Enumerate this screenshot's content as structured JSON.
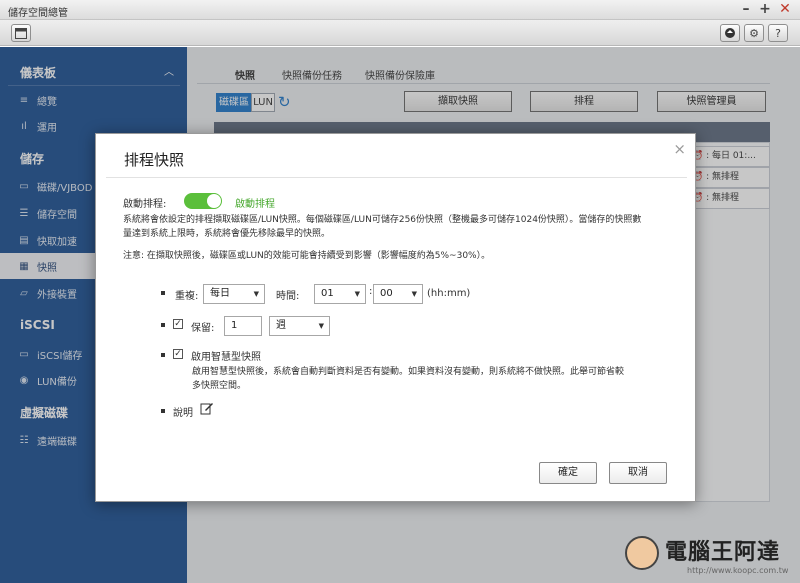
{
  "window": {
    "title": "儲存空間總管",
    "min": "–",
    "max": "+",
    "close": "✕"
  },
  "sidebar": {
    "sections": [
      {
        "label": "儀表板",
        "collapse": "︿"
      },
      {
        "label": "儲存"
      },
      {
        "label": "iSCSI"
      },
      {
        "label": "虛擬磁碟"
      }
    ],
    "items": [
      {
        "label": "總覽",
        "icon": "≡"
      },
      {
        "label": "運用",
        "icon": "ıl"
      },
      {
        "label": "磁碟/VJBOD",
        "icon": "▭"
      },
      {
        "label": "儲存空間",
        "icon": "☰"
      },
      {
        "label": "快取加速",
        "icon": "▤"
      },
      {
        "label": "快照",
        "icon": "▦"
      },
      {
        "label": "外接裝置",
        "icon": "▱"
      },
      {
        "label": "iSCSI儲存",
        "icon": "▭"
      },
      {
        "label": "LUN備份",
        "icon": "◉"
      },
      {
        "label": "遠端磁碟",
        "icon": "☷"
      }
    ]
  },
  "main": {
    "tabs": [
      "快照",
      "快照備份任務",
      "快照備份保險庫"
    ],
    "segments": [
      "磁碟區",
      "LUN"
    ],
    "buttons": [
      "擷取快照",
      "排程",
      "快照管理員"
    ],
    "rows": [
      "每日 01:...",
      "無排程",
      "無排程"
    ]
  },
  "dialog": {
    "title": "排程快照",
    "close": "×",
    "enable_label": "啟動排程:",
    "enable_status": "啟動排程",
    "desc1": "系統將會依設定的排程擷取磁碟區/LUN快照。每個磁碟區/LUN可儲存256份快照（整機最多可儲存1024份快照）。當儲存的快照數",
    "desc2": "量達到系統上限時，系統將會優先移除最早的快照。",
    "note": "注意: 在擷取快照後，磁碟區或LUN的效能可能會持續受到影響（影響幅度約為5%~30%）。",
    "repeat_label": "重複:",
    "repeat_value": "每日",
    "time_label": "時間:",
    "hour": "01",
    "minute": "00",
    "time_unit": "(hh:mm)",
    "keep_label": "保留:",
    "keep_value": "1",
    "keep_unit": "週",
    "smart_label": "啟用智慧型快照",
    "smart_desc1": "啟用智慧型快照後，系統會自動判斷資料是否有變動。如果資料沒有變動，則系統將不做快照。此舉可節省較",
    "smart_desc2": "多快照空間。",
    "note_label": "說明",
    "ok": "確定",
    "cancel": "取消"
  },
  "watermark": {
    "text": "電腦王阿達",
    "url": "http://www.koopc.com.tw"
  }
}
